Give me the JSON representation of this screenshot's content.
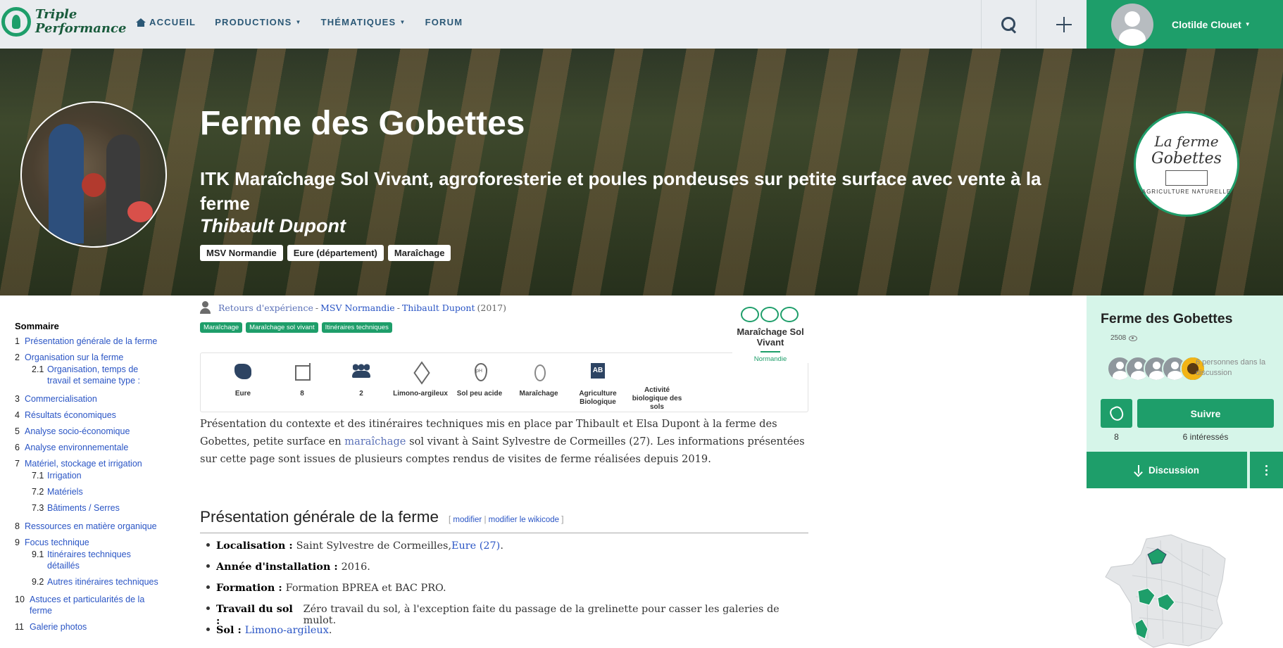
{
  "nav": {
    "logo_line1": "Triple",
    "logo_line2": "Performance",
    "links": [
      {
        "label": "ACCUEIL"
      },
      {
        "label": "PRODUCTIONS"
      },
      {
        "label": "THÉMATIQUES"
      },
      {
        "label": "FORUM"
      }
    ],
    "user_name": "Clotilde Clouet"
  },
  "hero": {
    "title": "Ferme des Gobettes",
    "subtitle": "ITK Maraîchage Sol Vivant, agroforesterie et poules pondeuses sur petite surface avec vente à la ferme",
    "author": "Thibault Dupont",
    "tags": [
      "MSV Normandie",
      "Eure (département)",
      "Maraîchage"
    ],
    "farm_logo": {
      "line1": "La ferme",
      "line2": "Gobettes",
      "line3": "AGRICULTURE NATURELLE"
    }
  },
  "toc": {
    "title": "Sommaire",
    "items": [
      {
        "num": "1",
        "label": "Présentation générale de la ferme"
      },
      {
        "num": "2",
        "label": "Organisation sur la ferme"
      },
      {
        "num": "2.1",
        "label": "Organisation, temps de travail et semaine type :"
      },
      {
        "num": "3",
        "label": "Commercialisation"
      },
      {
        "num": "4",
        "label": "Résultats économiques"
      },
      {
        "num": "5",
        "label": "Analyse socio-économique"
      },
      {
        "num": "6",
        "label": "Analyse environnementale"
      },
      {
        "num": "7",
        "label": "Matériel, stockage et irrigation"
      },
      {
        "num": "7.1",
        "label": "Irrigation"
      },
      {
        "num": "7.2",
        "label": "Matériels"
      },
      {
        "num": "7.3",
        "label": "Bâtiments / Serres"
      },
      {
        "num": "8",
        "label": "Ressources en matière organique"
      },
      {
        "num": "9",
        "label": "Focus technique"
      },
      {
        "num": "9.1",
        "label": "Itinéraires techniques détaillés"
      },
      {
        "num": "9.2",
        "label": "Autres itinéraires techniques"
      },
      {
        "num": "10",
        "label": "Astuces et particularités de la ferme"
      },
      {
        "num": "11",
        "label": "Galerie photos"
      }
    ]
  },
  "breadcrumb": {
    "items": [
      "Retours d'expérience",
      "MSV Normandie",
      "Thibault Dupont"
    ],
    "sep": "-",
    "year": "(2017)"
  },
  "keywords": [
    "Maraîchage",
    "Maraîchage sol vivant",
    "Itinéraires techniques"
  ],
  "msv": {
    "name": "Maraîchage Sol Vivant",
    "region": "Normandie"
  },
  "info_items": [
    {
      "icon": "map-icon",
      "label": "Eure"
    },
    {
      "icon": "dimensions-icon",
      "label": "8"
    },
    {
      "icon": "people-icon",
      "label": "2"
    },
    {
      "icon": "soil-icon",
      "label": "Limono-argileux"
    },
    {
      "icon": "ph-icon",
      "label": "Sol peu acide"
    },
    {
      "icon": "vegetable-icon",
      "label": "Maraîchage"
    },
    {
      "icon": "organic-label-icon",
      "label": "Agriculture Biologique"
    },
    {
      "icon": "soil-activity-icon",
      "label": "Activité biologique des sols"
    }
  ],
  "intro": {
    "before": "Présentation du contexte et des itinéraires techniques mis en place par Thibault et Elsa Dupont à la ferme des Gobettes, petite surface en ",
    "link": "maraîchage",
    "after": " sol vivant à Saint Sylvestre de Cormeilles (27). Les informations présentées sur cette page sont issues de plusieurs comptes rendus de visites de ferme réalisées depuis 2019."
  },
  "section": {
    "title": "Présentation générale de la ferme",
    "edit": "modifier",
    "edit_wikicode": "modifier le wikicode"
  },
  "facts": [
    {
      "label": "Localisation :",
      "text": "Saint Sylvestre de Cormeilles, ",
      "link": "Eure (27)",
      "tail": "."
    },
    {
      "label": "Année d'installation :",
      "text": "2016.",
      "link": "",
      "tail": ""
    },
    {
      "label": "Formation :",
      "text": "Formation BPREA et BAC PRO.",
      "link": "",
      "tail": ""
    },
    {
      "label": "Travail du sol :",
      "text": "Zéro travail du sol, à l'exception faite du passage de la grelinette pour casser les galeries de mulot.",
      "link": "",
      "tail": ""
    },
    {
      "label": "Sol :",
      "text": "",
      "link": "Limono-argileux",
      "tail": "."
    }
  ],
  "panel": {
    "title": "Ferme des Gobettes",
    "views": "2508",
    "discussion_count": "6 personnes dans la discussion",
    "claps": "8",
    "follow_label": "Suivre",
    "follow_count": "6 intéressés",
    "discussion_label": "Discussion"
  },
  "colors": {
    "accent": "#1e9e6a",
    "panel_bg": "#d6f5e9",
    "link": "#2a55c5"
  }
}
